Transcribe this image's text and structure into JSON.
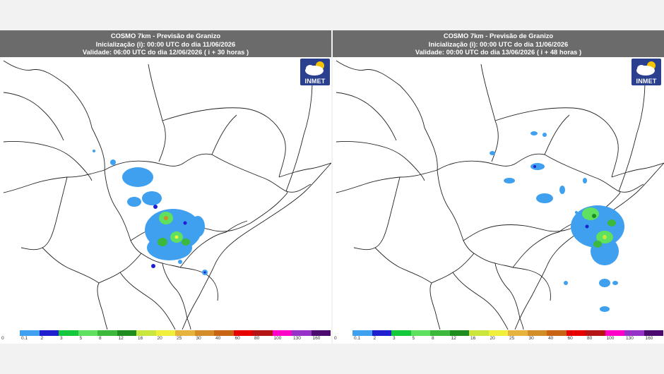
{
  "panels": [
    {
      "title": "COSMO 7km - Previsão de Granizo",
      "init_line": "Inicialização (i): 00:00 UTC do dia 11/06/2026",
      "valid_line": "Validade: 06:00 UTC do dia 12/06/2026 ( i + 30 horas )",
      "logo_text": "INMET"
    },
    {
      "title": "COSMO 7km - Previsão de Granizo",
      "init_line": "Inicialização (i): 00:00 UTC do dia 11/06/2026",
      "valid_line": "Validade: 00:00 UTC do dia 13/06/2026 ( i + 48 horas )",
      "logo_text": "INMET"
    }
  ],
  "colorbar": {
    "labels": [
      "0",
      "0.1",
      "2",
      "3",
      "5",
      "8",
      "12",
      "16",
      "20",
      "25",
      "30",
      "40",
      "60",
      "80",
      "100",
      "130",
      "160"
    ],
    "colors": [
      "#ffffff",
      "#3fa0ef",
      "#1f1fd0",
      "#14c83c",
      "#5fe05f",
      "#3cb83c",
      "#1e8c1e",
      "#c8e63c",
      "#f0f03c",
      "#e6b43c",
      "#d28c28",
      "#c86414",
      "#e60000",
      "#b41414",
      "#ff00c8",
      "#9632c8",
      "#4b0a6e"
    ]
  }
}
